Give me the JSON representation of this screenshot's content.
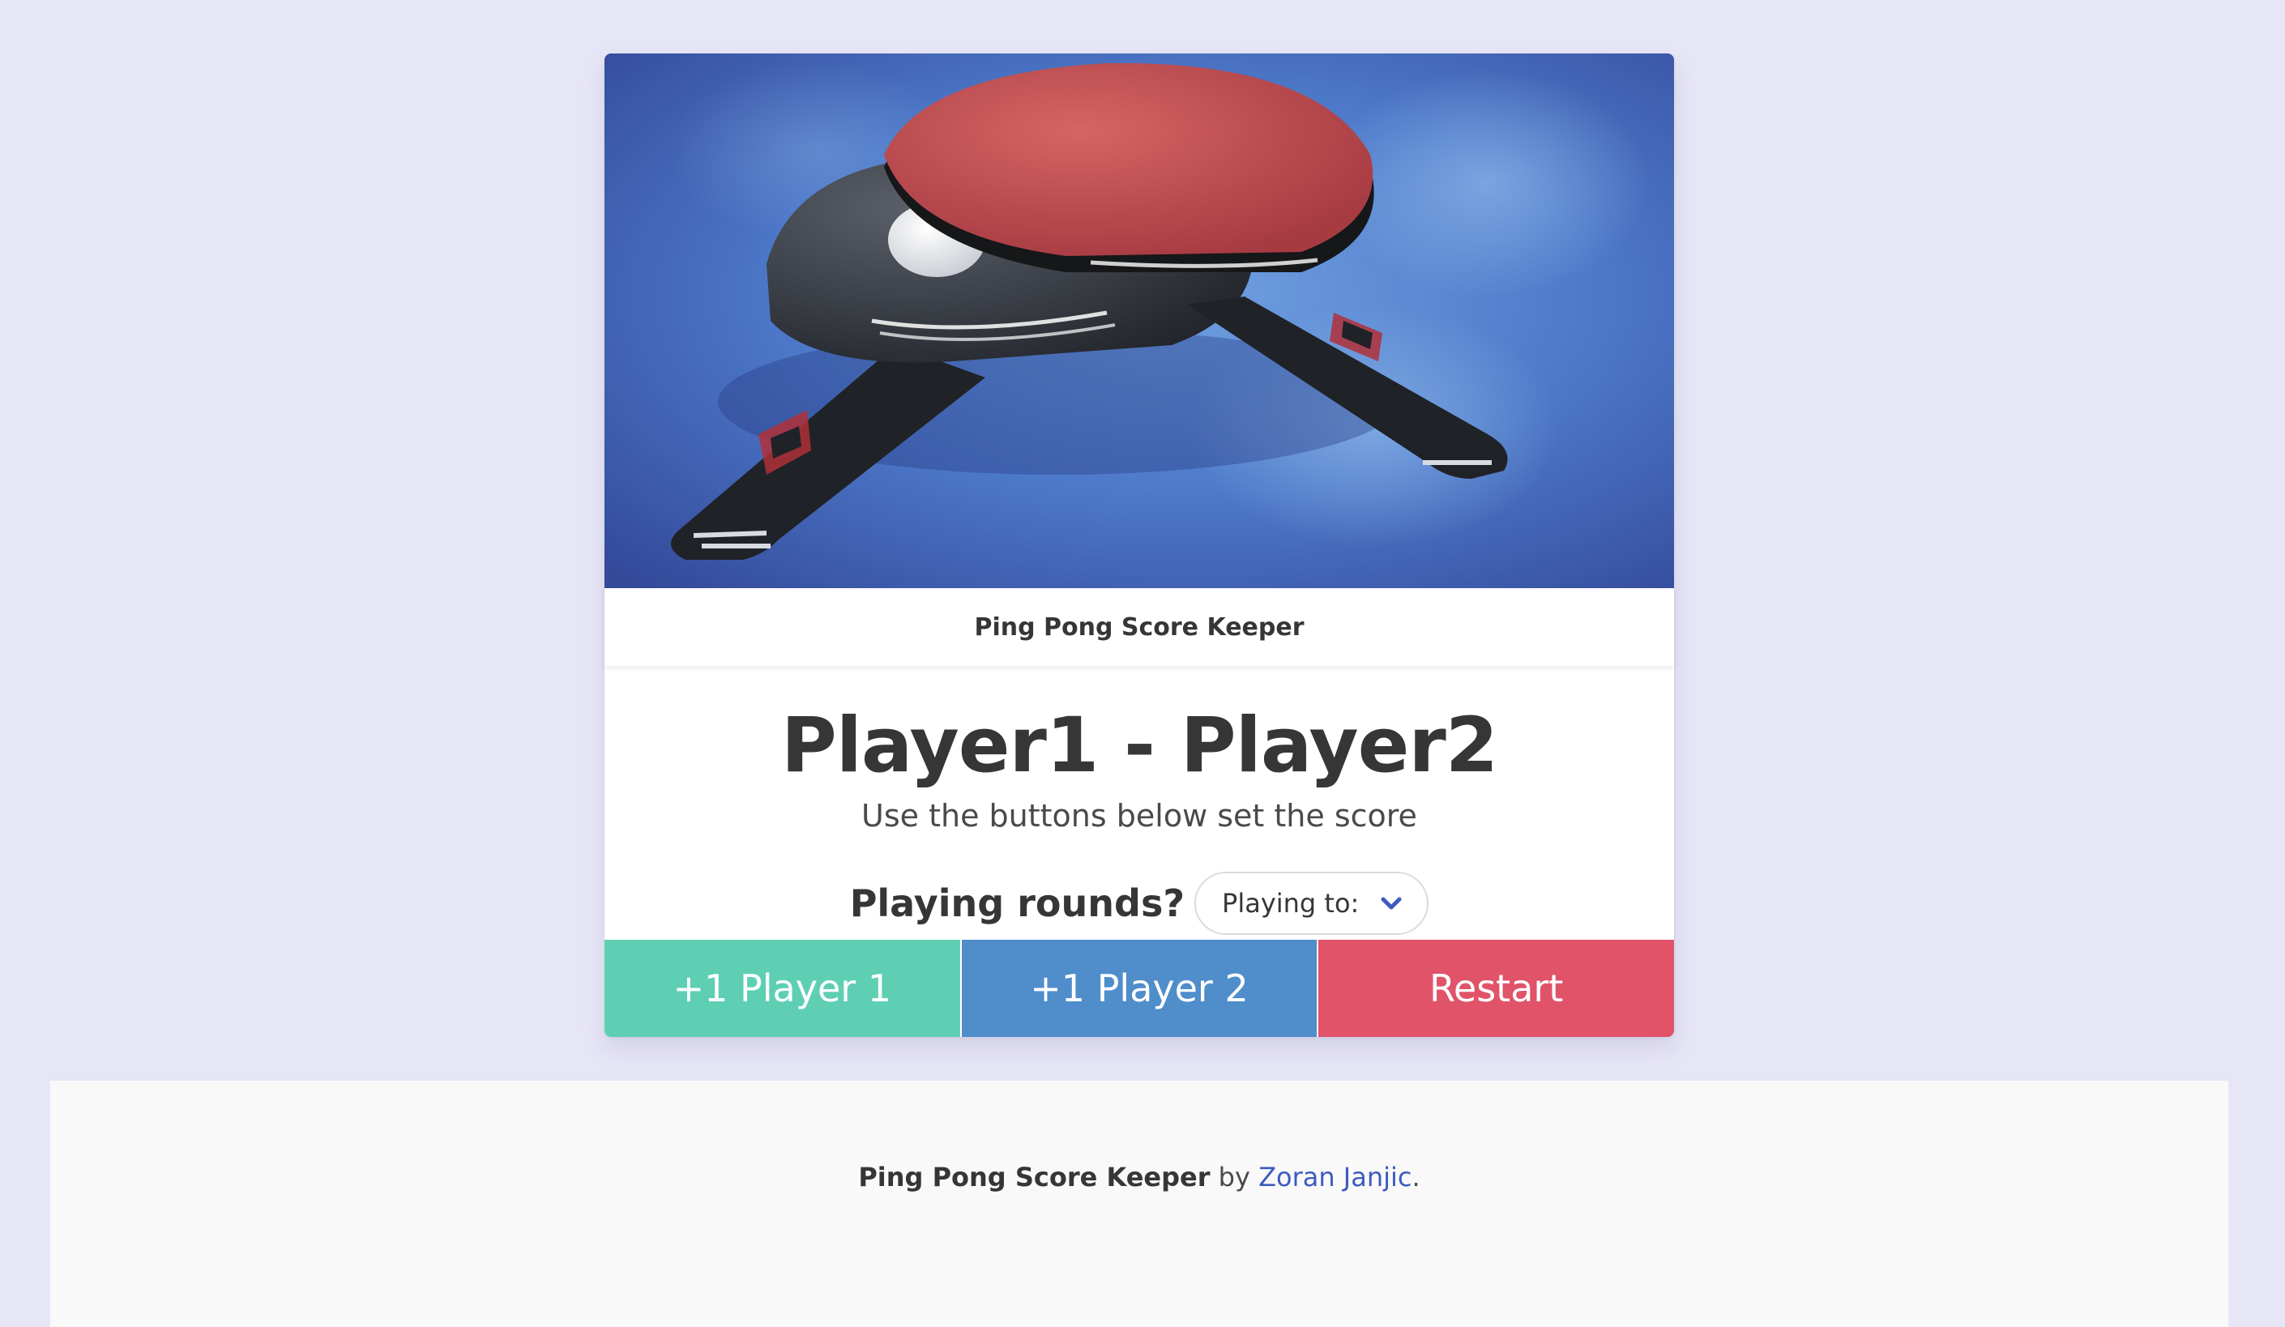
{
  "theme": {
    "page_background": "#e7e6f7",
    "player1_color": "#5fcfb4",
    "player2_color": "#4f8dcb",
    "restart_color": "#e05369",
    "link_color": "#3d5bbf",
    "chevron_color": "#3d5bbf"
  },
  "hero": {
    "image": "ping-pong-paddles-illustration"
  },
  "card": {
    "header_title": "Ping Pong Score Keeper",
    "score_title": "Player1 - Player2",
    "subtitle": "Use the buttons below set the score",
    "rounds_label": "Playing rounds?",
    "select": {
      "selected": "Playing to:",
      "icon": "chevron-down-icon"
    }
  },
  "buttons": {
    "player1": "+1 Player 1",
    "player2": "+1 Player 2",
    "restart": "Restart"
  },
  "footer": {
    "app_name": "Ping Pong Score Keeper",
    "by_text": " by ",
    "author": "Zoran Janjic",
    "end_text": "."
  }
}
